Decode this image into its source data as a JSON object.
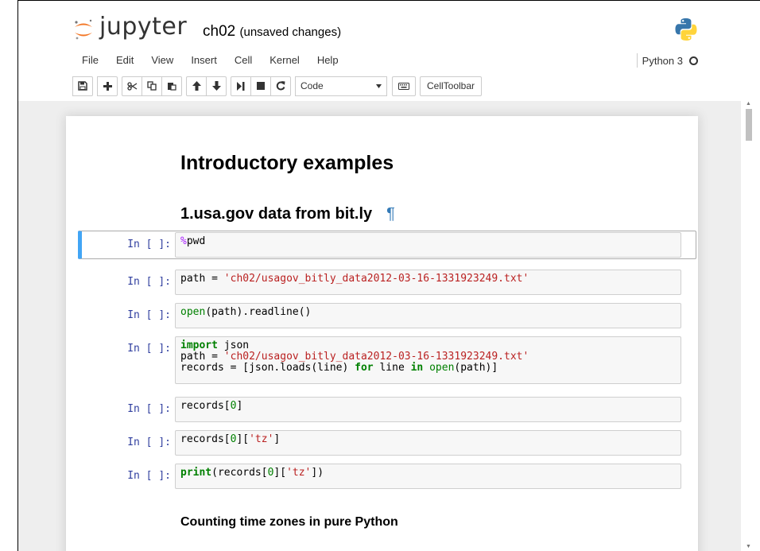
{
  "header": {
    "logo_text": "jupyter",
    "notebook_name": "ch02",
    "save_status": "(unsaved changes)",
    "kernel_name": "Python 3"
  },
  "menu": [
    "File",
    "Edit",
    "View",
    "Insert",
    "Cell",
    "Kernel",
    "Help"
  ],
  "toolbar": {
    "cell_type": "Code",
    "celltoolbar_label": "CellToolbar",
    "icons": [
      "save-icon",
      "plus-icon",
      "cut-icon",
      "copy-icon",
      "paste-icon",
      "arrow-up-icon",
      "arrow-down-icon",
      "run-icon",
      "stop-icon",
      "restart-icon",
      "keyboard-icon"
    ]
  },
  "notebook": {
    "heading1": "Introductory examples",
    "heading2": "1.usa.gov data from bit.ly",
    "pilcrow": "¶",
    "heading4": "Counting time zones in pure Python",
    "prompt_label": "In [ ]:",
    "cells": [
      {
        "tokens": [
          [
            {
              "t": "%",
              "c": "magic"
            },
            {
              "t": "pwd",
              "c": ""
            }
          ]
        ]
      },
      {
        "tokens": [
          [
            {
              "t": "path = ",
              "c": ""
            },
            {
              "t": "'ch02/usagov_bitly_data2012-03-16-1331923249.txt'",
              "c": "str"
            }
          ]
        ]
      },
      {
        "tokens": [
          [
            {
              "t": "open",
              "c": "bi"
            },
            {
              "t": "(path).readline()",
              "c": ""
            }
          ]
        ]
      },
      {
        "tokens": [
          [
            {
              "t": "import",
              "c": "kw"
            },
            {
              "t": " json",
              "c": ""
            }
          ],
          [
            {
              "t": "path = ",
              "c": ""
            },
            {
              "t": "'ch02/usagov_bitly_data2012-03-16-1331923249.txt'",
              "c": "str"
            }
          ],
          [
            {
              "t": "records = [json.loads(line) ",
              "c": ""
            },
            {
              "t": "for",
              "c": "kw"
            },
            {
              "t": " line ",
              "c": ""
            },
            {
              "t": "in",
              "c": "kw"
            },
            {
              "t": " ",
              "c": ""
            },
            {
              "t": "open",
              "c": "bi"
            },
            {
              "t": "(path)]",
              "c": ""
            }
          ]
        ]
      },
      {
        "tokens": [
          [
            {
              "t": "records[",
              "c": ""
            },
            {
              "t": "0",
              "c": "num"
            },
            {
              "t": "]",
              "c": ""
            }
          ]
        ]
      },
      {
        "tokens": [
          [
            {
              "t": "records[",
              "c": ""
            },
            {
              "t": "0",
              "c": "num"
            },
            {
              "t": "][",
              "c": ""
            },
            {
              "t": "'tz'",
              "c": "str"
            },
            {
              "t": "]",
              "c": ""
            }
          ]
        ]
      },
      {
        "tokens": [
          [
            {
              "t": "print",
              "c": "kw"
            },
            {
              "t": "(records[",
              "c": ""
            },
            {
              "t": "0",
              "c": "num"
            },
            {
              "t": "][",
              "c": ""
            },
            {
              "t": "'tz'",
              "c": "str"
            },
            {
              "t": "])",
              "c": ""
            }
          ]
        ]
      }
    ]
  },
  "colors": {
    "selected_cell_border": "#42a5f5",
    "prompt": "#303f9f",
    "keyword": "#008000",
    "string": "#ba2121",
    "magic": "#aa22ff",
    "link": "#337ab7"
  }
}
